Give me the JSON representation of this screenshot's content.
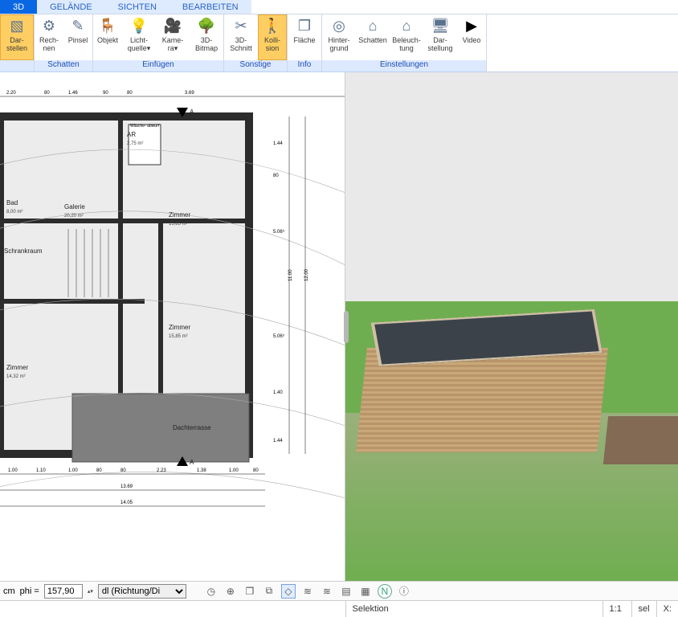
{
  "tabs": [
    "3D",
    "GELÄNDE",
    "SICHTEN",
    "BEARBEITEN"
  ],
  "active_tab": 0,
  "ribbon": {
    "groups": [
      {
        "label": "",
        "buttons": [
          {
            "id": "display",
            "label": "Dar-\nstellen",
            "glyph": "▧",
            "selected": true
          }
        ]
      },
      {
        "label": "Schatten",
        "buttons": [
          {
            "id": "calc",
            "label": "Rech-\nnen",
            "glyph": "⚙"
          },
          {
            "id": "brush",
            "label": "Pinsel",
            "glyph": "✎"
          }
        ]
      },
      {
        "label": "Einfügen",
        "buttons": [
          {
            "id": "object",
            "label": "Objekt",
            "glyph": "🪑"
          },
          {
            "id": "light",
            "label": "Licht-\nquelle▾",
            "glyph": "💡"
          },
          {
            "id": "camera",
            "label": "Kame-\nra▾",
            "glyph": "🎥"
          },
          {
            "id": "bitmap3d",
            "label": "3D-\nBitmap",
            "glyph": "🌳"
          }
        ]
      },
      {
        "label": "Sonstige",
        "buttons": [
          {
            "id": "section",
            "label": "3D-\nSchnitt",
            "glyph": "✂"
          },
          {
            "id": "collision",
            "label": "Kolli-\nsion",
            "glyph": "🚶",
            "selected": true
          }
        ]
      },
      {
        "label": "Info",
        "buttons": [
          {
            "id": "area",
            "label": "Fläche",
            "glyph": "❐"
          }
        ]
      },
      {
        "label": "Einstellungen",
        "buttons": [
          {
            "id": "bg",
            "label": "Hinter-\ngrund",
            "glyph": "◎"
          },
          {
            "id": "shadow",
            "label": "Schatten",
            "glyph": "⌂"
          },
          {
            "id": "lighting",
            "label": "Beleuch-\ntung",
            "glyph": "⌂"
          },
          {
            "id": "present",
            "label": "Dar-\nstellung",
            "glyph": "🖥"
          },
          {
            "id": "video",
            "label": "Video",
            "glyph": "▶"
          }
        ]
      }
    ]
  },
  "plan": {
    "top_dims": [
      "2.20",
      "80",
      "1.46",
      "90",
      "80",
      "3.69"
    ],
    "right_dims": [
      "1.44",
      "80",
      "5.06⁵",
      "11.00",
      "12.00",
      "5.06⁵",
      "1.40",
      "1.44"
    ],
    "bottom_dims_1": [
      "1.00",
      "1.10",
      "1.00",
      "80",
      "80",
      "2.23",
      "1.38",
      "1.00",
      "80"
    ],
    "bottom_dims_2": "13.69",
    "bottom_dims_3": "14.05",
    "rooms": [
      {
        "name": "AR",
        "area": "2,75 m²",
        "note": "Wäsche-\nabwurf"
      },
      {
        "name": "Bad",
        "area": "8,00 m²"
      },
      {
        "name": "Galerie",
        "area": "20,20 m²"
      },
      {
        "name": "Zimmer",
        "area": "15,85 m²"
      },
      {
        "name": "Schrankraum",
        "area": ""
      },
      {
        "name": "Zimmer",
        "area": "15,85 m²"
      },
      {
        "name": "Zimmer",
        "area": "14,32 m²"
      },
      {
        "name": "Dachterrasse",
        "area": ""
      }
    ],
    "section_marker": "A"
  },
  "bottombar": {
    "unit": "cm",
    "phi_label": "phi  =",
    "phi_value": "157,90",
    "dl_label": "dl (Richtung/Di"
  },
  "status": {
    "left": "",
    "selection_label": "Selektion",
    "ratio": "1:1",
    "sel": "sel",
    "x": "X:"
  }
}
